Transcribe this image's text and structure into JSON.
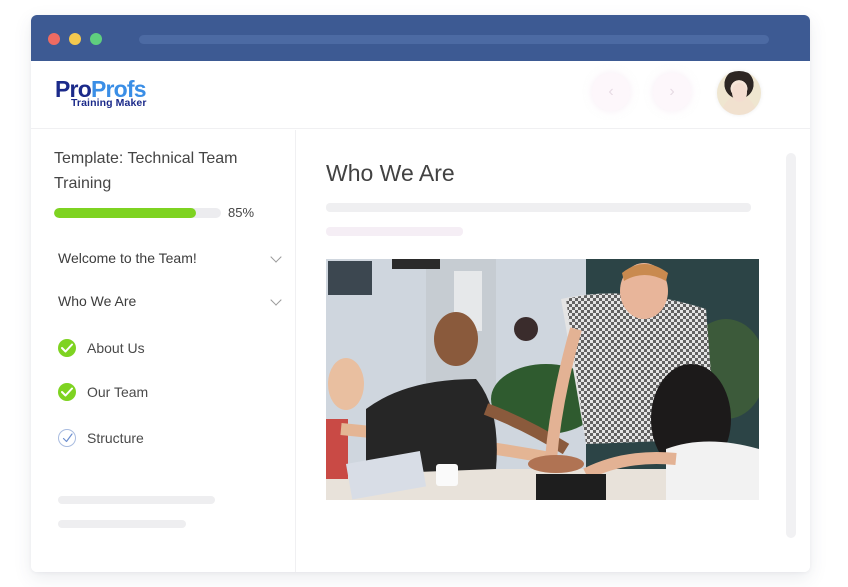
{
  "window": {
    "controls": [
      "close",
      "minimize",
      "maximize"
    ]
  },
  "header": {
    "logo": {
      "brand_part1": "Pro",
      "brand_part2": "Profs",
      "product": "Training Maker"
    },
    "nav": {
      "prev_icon": "‹",
      "next_icon": "›"
    },
    "avatar_alt": "User avatar"
  },
  "sidebar": {
    "course_title": "Template: Technical Team Training",
    "progress": {
      "percent": 85,
      "label": "85%"
    },
    "sections": [
      {
        "label": "Welcome to the Team!",
        "expanded": false
      },
      {
        "label": "Who We Are",
        "expanded": true
      }
    ],
    "lessons": [
      {
        "label": "About Us",
        "status": "completed"
      },
      {
        "label": "Our Team",
        "status": "completed"
      },
      {
        "label": "Structure",
        "status": "current"
      }
    ]
  },
  "main": {
    "title": "Who We Are",
    "image_alt": "Team members stacking hands together around a table"
  },
  "colors": {
    "titlebar": "#3d5a93",
    "progress": "#7ed321",
    "brand_dark": "#1b2a8a",
    "brand_light": "#3a8ee6"
  }
}
